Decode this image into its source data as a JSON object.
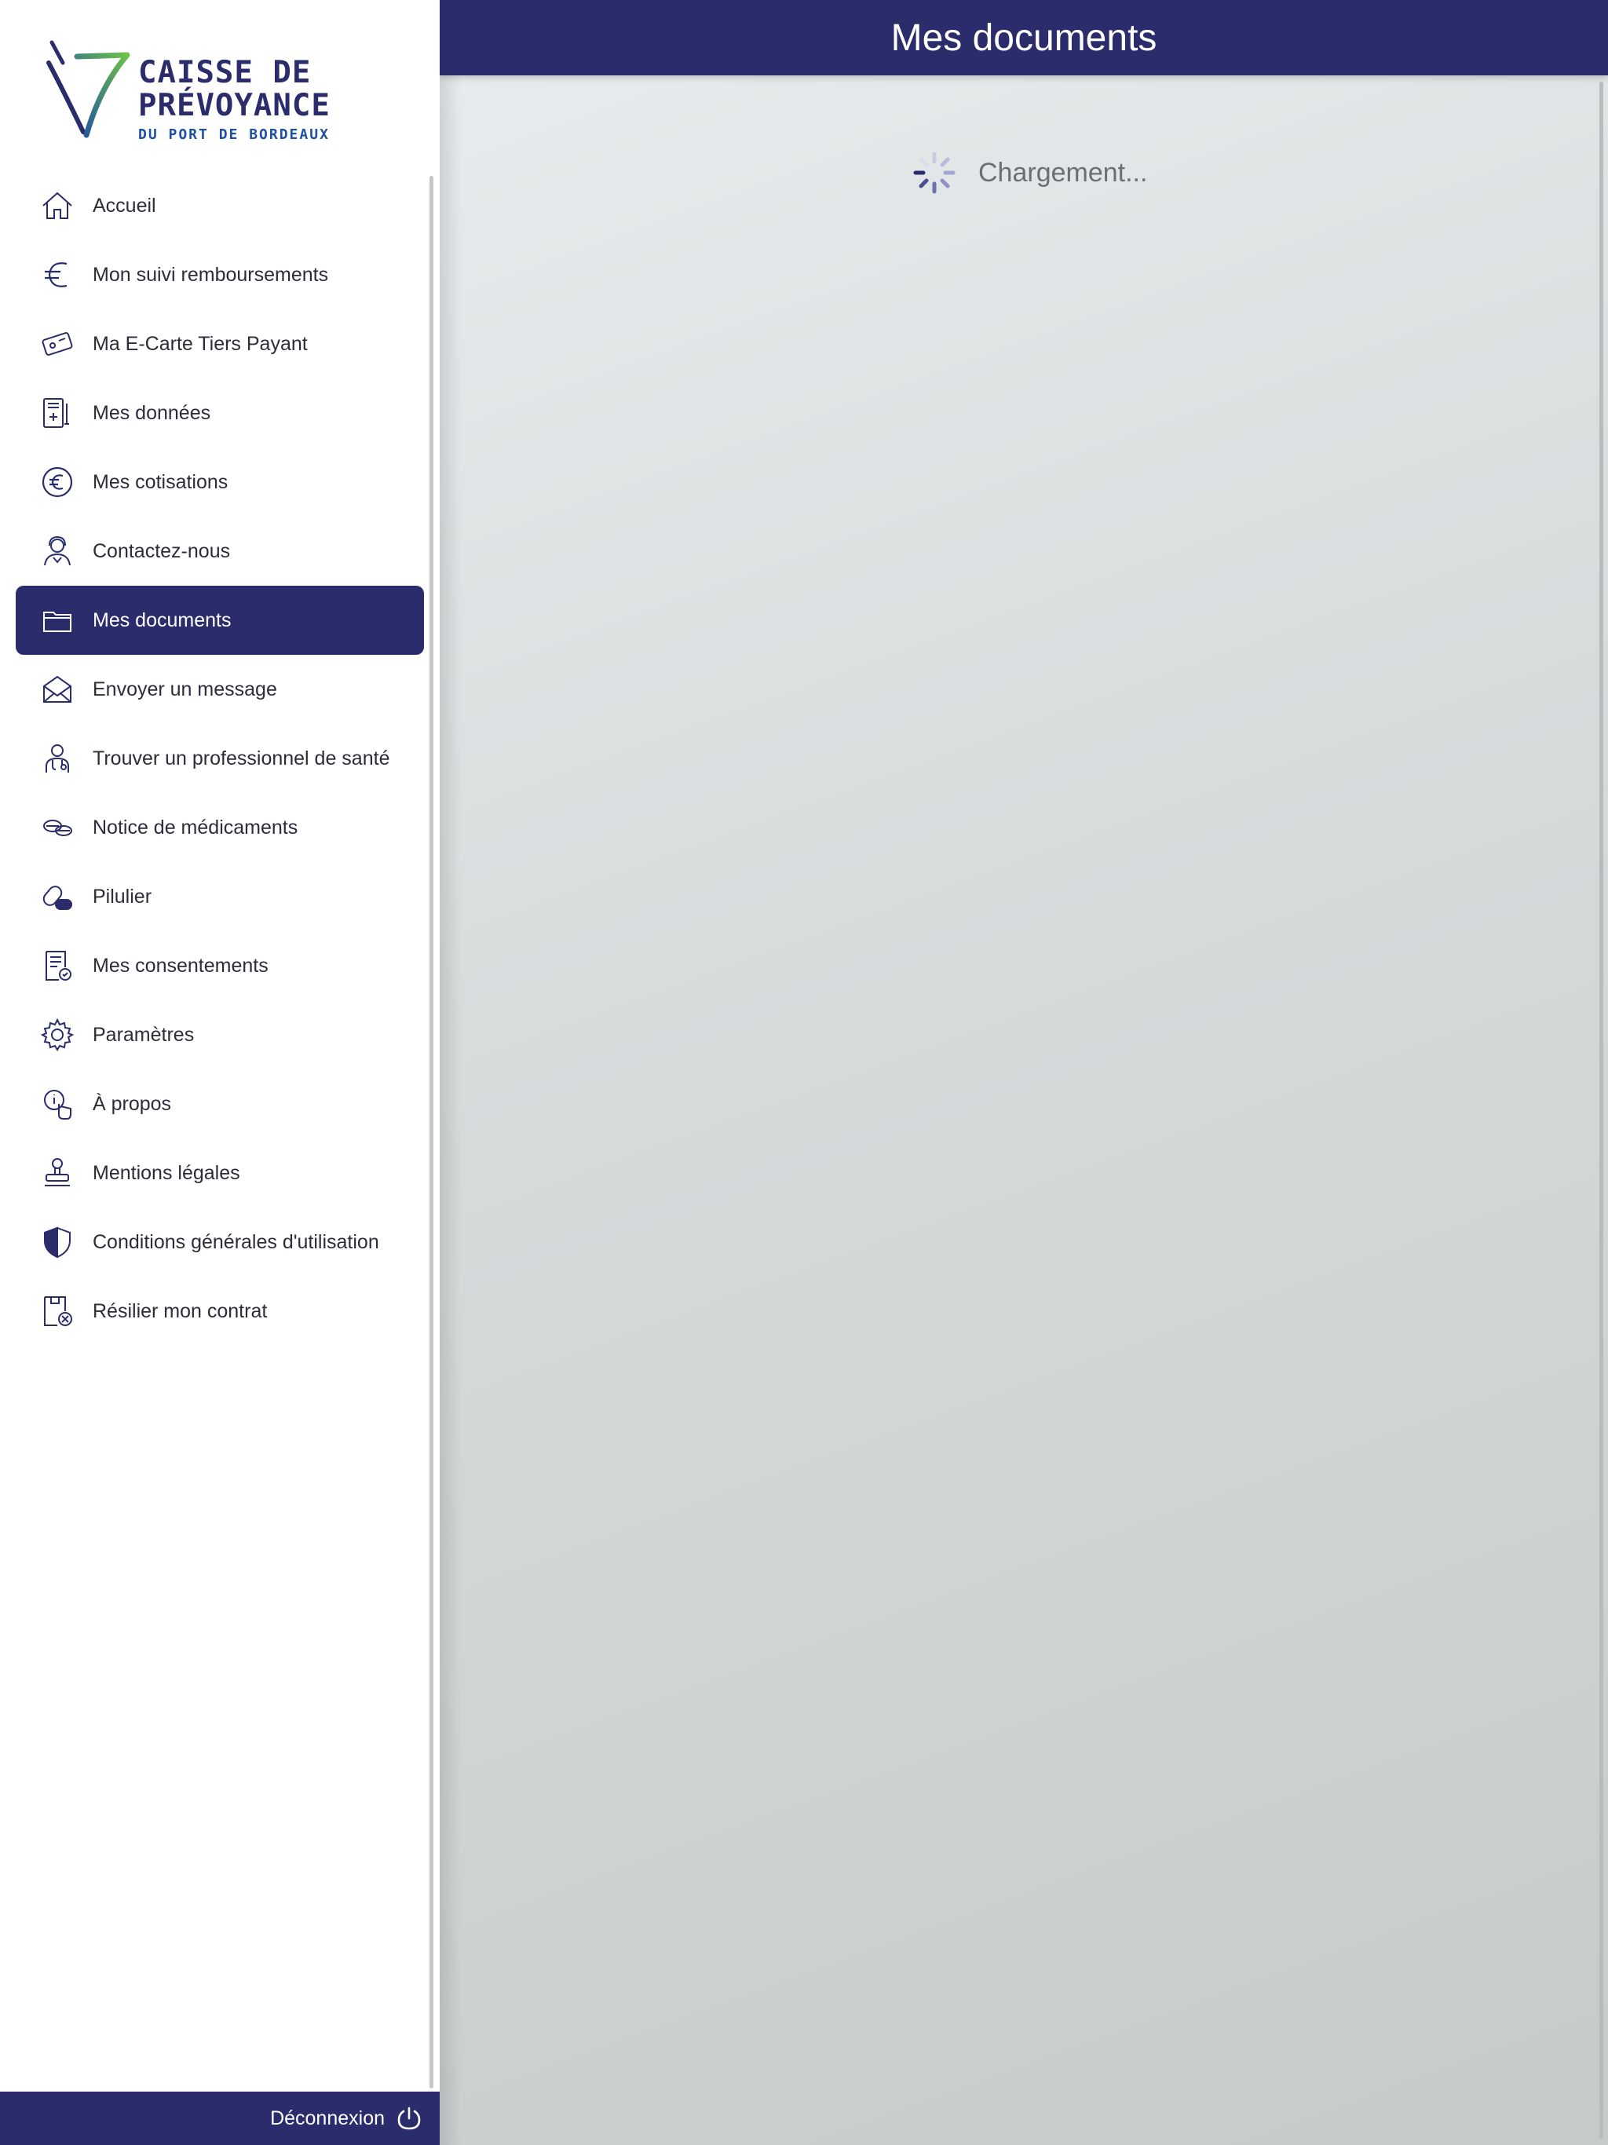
{
  "brand": {
    "line1": "CAISSE DE",
    "line2": "PRÉVOYANCE",
    "line3": "DU PORT DE BORDEAUX"
  },
  "colors": {
    "primary": "#2b2c6c",
    "logo_green": "#5cc36b",
    "logo_blue": "#1f4fa3"
  },
  "sidebar": {
    "items": [
      {
        "label": "Accueil",
        "icon": "home-icon"
      },
      {
        "label": "Mon suivi remboursements",
        "icon": "euro-icon"
      },
      {
        "label": "Ma E-Carte Tiers Payant",
        "icon": "card-icon"
      },
      {
        "label": "Mes données",
        "icon": "medical-file-icon"
      },
      {
        "label": "Mes cotisations",
        "icon": "euro-circle-icon"
      },
      {
        "label": "Contactez-nous",
        "icon": "support-agent-icon"
      },
      {
        "label": "Mes documents",
        "icon": "folder-icon",
        "active": true
      },
      {
        "label": "Envoyer un message",
        "icon": "envelope-icon"
      },
      {
        "label": "Trouver un professionnel de santé",
        "icon": "doctor-icon"
      },
      {
        "label": "Notice de médicaments",
        "icon": "pills-icon"
      },
      {
        "label": "Pilulier",
        "icon": "pill-box-icon"
      },
      {
        "label": "Mes consentements",
        "icon": "consent-document-icon"
      },
      {
        "label": "Paramètres",
        "icon": "gear-icon"
      },
      {
        "label": "À propos",
        "icon": "info-touch-icon"
      },
      {
        "label": "Mentions légales",
        "icon": "stamp-icon"
      },
      {
        "label": "Conditions générales d'utilisation",
        "icon": "shield-icon"
      },
      {
        "label": "Résilier mon contrat",
        "icon": "cancel-contract-icon"
      }
    ],
    "logout_label": "Déconnexion"
  },
  "header": {
    "title": "Mes documents"
  },
  "main": {
    "loading_label": "Chargement..."
  }
}
